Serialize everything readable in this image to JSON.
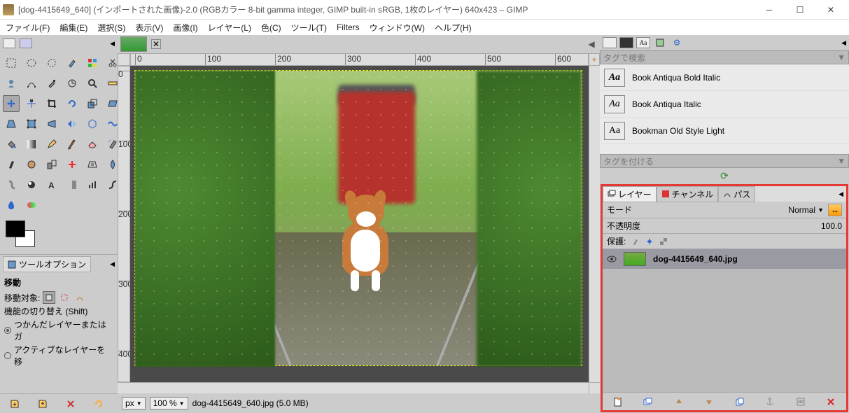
{
  "window": {
    "title": "[dog-4415649_640] (インポートされた画像)-2.0 (RGBカラー 8-bit gamma integer, GIMP built-in sRGB, 1枚のレイヤー) 640x423 – GIMP"
  },
  "menu": {
    "file": "ファイル(F)",
    "edit": "編集(E)",
    "select": "選択(S)",
    "view": "表示(V)",
    "image": "画像(I)",
    "layer": "レイヤー(L)",
    "color": "色(C)",
    "tools": "ツール(T)",
    "filters": "Filters",
    "window": "ウィンドウ(W)",
    "help": "ヘルプ(H)"
  },
  "toolbox": {
    "options_tab": "ツールオプション",
    "tool_name": "移動",
    "move_target_label": "移動対象:",
    "toggle_label": "機能の切り替え (Shift)",
    "opt1": "つかんだレイヤーまたはガ",
    "opt2": "アクティブなレイヤーを移"
  },
  "ruler": {
    "h": [
      "0",
      "100",
      "200",
      "300",
      "400",
      "500",
      "600"
    ],
    "v": [
      "0",
      "100",
      "200",
      "300",
      "400"
    ]
  },
  "status": {
    "unit": "px",
    "zoom": "100 %",
    "file_info": "dog-4415649_640.jpg (5.0 MB)"
  },
  "fonts": {
    "filter_placeholder": "タグで検索",
    "tag_placeholder": "タグを付ける",
    "items": [
      "Book Antiqua Bold Italic",
      "Book Antiqua Italic",
      "Bookman Old Style Light"
    ]
  },
  "layers": {
    "tab_layers": "レイヤー",
    "tab_channels": "チャンネル",
    "tab_paths": "パス",
    "mode_label": "モード",
    "mode_value": "Normal",
    "opacity_label": "不透明度",
    "opacity_value": "100.0",
    "lock_label": "保護:",
    "layer_name": "dog-4415649_640.jpg"
  }
}
